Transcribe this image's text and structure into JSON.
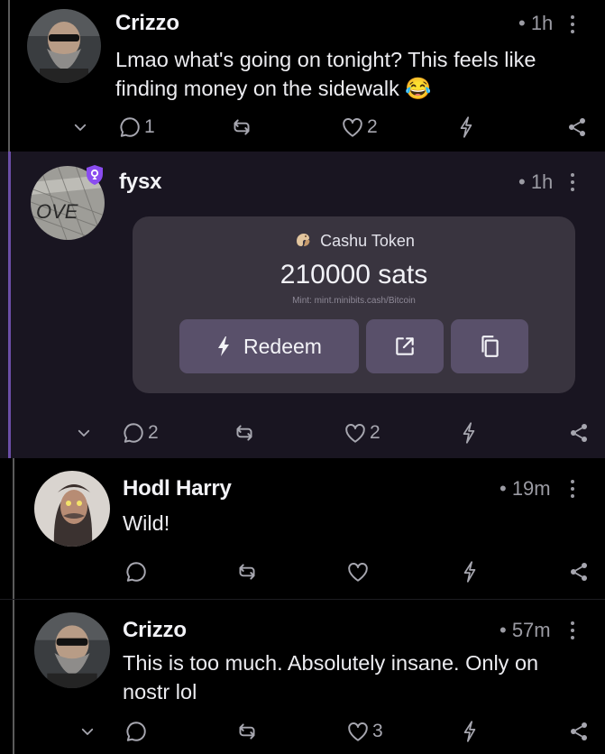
{
  "posts": [
    {
      "author": "Crizzo",
      "time": "• 1h",
      "text": "Lmao what's going on tonight? This feels like finding money on the sidewalk 😂",
      "replies": "1",
      "likes": "2"
    },
    {
      "author": "fysx",
      "time": "• 1h",
      "replies": "2",
      "likes": "2",
      "cashu": {
        "label": "Cashu Token",
        "amount": "210000 sats",
        "mint": "Mint: mint.minibits.cash/Bitcoin",
        "redeem_label": "Redeem"
      }
    },
    {
      "author": "Hodl Harry",
      "time": "• 19m",
      "text": "Wild!",
      "replies": "",
      "likes": ""
    },
    {
      "author": "Crizzo",
      "time": "• 57m",
      "text": "This is too much. Absolutely insane. Only on nostr lol",
      "replies": "",
      "likes": "3"
    }
  ],
  "colors": {
    "background": "#000000",
    "highlight_background": "#191521",
    "accent_purple": "#6b4ea6",
    "card": "#39343f",
    "button": "#59506a",
    "muted": "#9b9ba3"
  },
  "icons": [
    "reply-icon",
    "repost-icon",
    "like-icon",
    "zap-icon",
    "share-icon",
    "chevron-down-icon",
    "more-icon",
    "verified-badge-icon",
    "external-link-icon",
    "copy-icon"
  ]
}
